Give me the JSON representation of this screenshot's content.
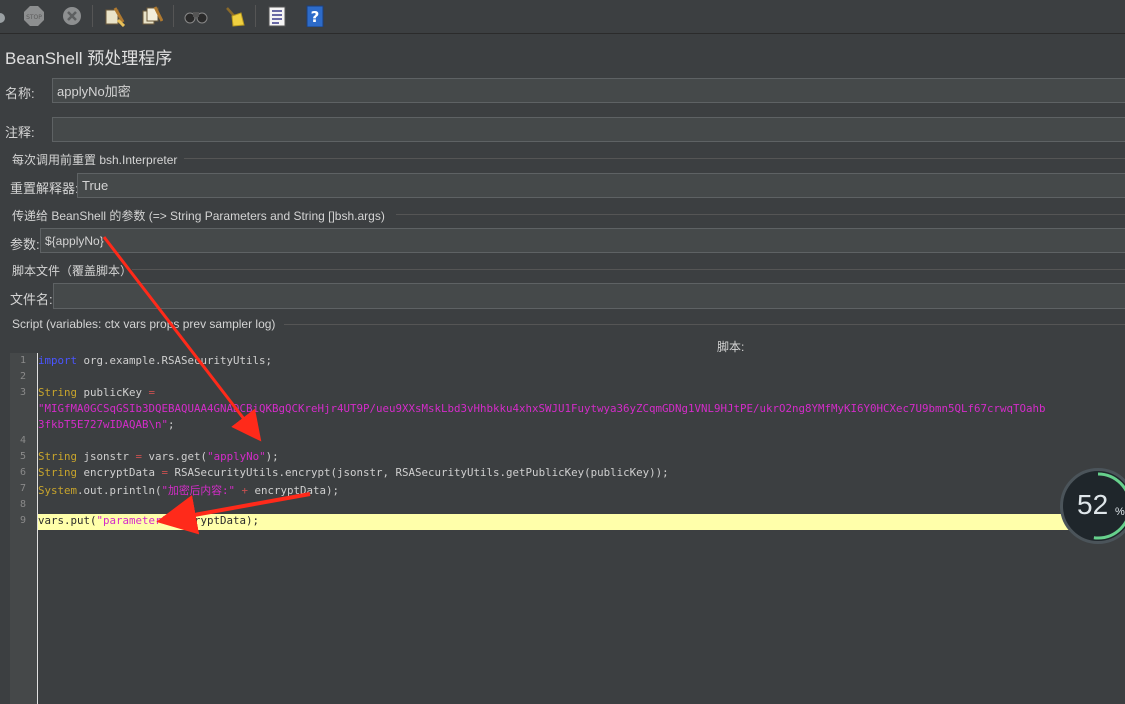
{
  "panel": {
    "title": "BeanShell 预处理程序"
  },
  "name_field": {
    "label": "名称:",
    "value": "applyNo加密"
  },
  "comment_field": {
    "label": "注释:",
    "value": ""
  },
  "reset_group": {
    "title": "每次调用前重置 bsh.Interpreter",
    "label": "重置解释器:",
    "value": "True"
  },
  "params_group": {
    "title": "传递给 BeanShell 的参数 (=> String Parameters and String []bsh.args)",
    "label": "参数:",
    "value": "${applyNo}"
  },
  "file_group": {
    "title": "脚本文件（覆盖脚本）",
    "label": "文件名:",
    "value": ""
  },
  "script_group": {
    "title": "Script (variables: ctx vars props prev sampler log)",
    "header": "脚本:"
  },
  "code": {
    "line_numbers": [
      "1",
      "2",
      "3",
      "4",
      "5",
      "6",
      "7",
      "8",
      "9"
    ],
    "l1_kw": "import",
    "l1_rest": " org.example.RSASecurityUtils;",
    "l3_type": "String",
    "l3_var": " publicKey ",
    "l3_eq": "=",
    "l3_str_a": "\"MIGfMA0GCSqGSIb3DQEBAQUAA4GNADCBiQKBgQCKreHjr4UT9P/ueu9XXsMskLbd3vHhbkku4xhxSWJU1Fuytwya36yZCqmGDNg1VNL9HJtPE/ukrO2ng8YMfMyKI6Y0HCXec7U9bmn5QLf67crwqTOahb",
    "l3_str_b": "3fkbT5E727wIDAQAB\\n\"",
    "l3_end": ";",
    "l5_type": "String",
    "l5_mid": " jsonstr ",
    "l5_eq": "=",
    "l5_call": " vars.get(",
    "l5_str": "\"applyNo\"",
    "l5_end": ");",
    "l6_type": "String",
    "l6_mid": " encryptData ",
    "l6_eq": "=",
    "l6_call": " RSASecurityUtils.encrypt(jsonstr, RSASecurityUtils.getPublicKey(publicKey));",
    "l7_kw": "System",
    "l7_call": ".out.println(",
    "l7_str": "\"加密后内容:\"",
    "l7_plus": " + ",
    "l7_end": "encryptData);",
    "l9_call": "vars.put(",
    "l9_str": "\"parameter\"",
    "l9_end": ",encryptData);"
  },
  "progress_badge": {
    "value": "52",
    "unit": "%",
    "fraction": 0.52
  },
  "colors": {
    "background": "#3c3f41",
    "field": "#45494a",
    "highlight_line": "#ffffaa",
    "keyword": "#4a55ff",
    "string": "#d42cc9",
    "type": "#c7a42c",
    "annotation_arrow": "#ff2a1a"
  }
}
